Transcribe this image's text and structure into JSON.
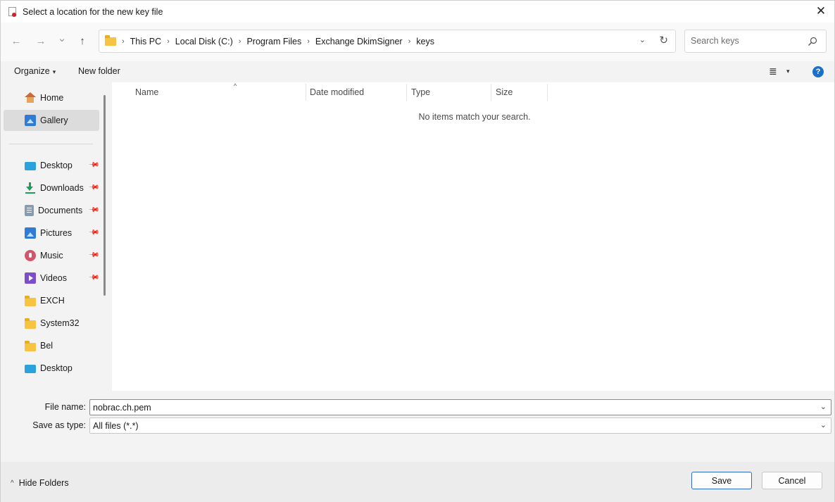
{
  "window": {
    "title": "Select a location for the new key file",
    "close_glyph": "✕"
  },
  "nav": {
    "back_glyph": "←",
    "forward_glyph": "→",
    "recent_glyph": "⌄",
    "up_glyph": "↑",
    "breadcrumbs": [
      "This PC",
      "Local Disk (C:)",
      "Program Files",
      "Exchange DkimSigner",
      "keys"
    ],
    "crumb_sep": "›",
    "address_dropdown_glyph": "⌄",
    "refresh_glyph": "↻",
    "search_placeholder": "Search keys"
  },
  "toolbar": {
    "organize_label": "Organize",
    "organize_caret": "▾",
    "new_folder_label": "New folder",
    "view_glyph": "≣",
    "view_caret": "▾",
    "help_glyph": "?"
  },
  "sidebar": {
    "items": [
      {
        "label": "Home",
        "icon": "home-icon",
        "pinned": false,
        "selected": false
      },
      {
        "label": "Gallery",
        "icon": "gallery-icon",
        "pinned": false,
        "selected": true
      },
      {
        "label": "Desktop",
        "icon": "desktop-icon",
        "pinned": true,
        "selected": false
      },
      {
        "label": "Downloads",
        "icon": "downloads-icon",
        "pinned": true,
        "selected": false
      },
      {
        "label": "Documents",
        "icon": "documents-icon",
        "pinned": true,
        "selected": false
      },
      {
        "label": "Pictures",
        "icon": "pictures-icon",
        "pinned": true,
        "selected": false
      },
      {
        "label": "Music",
        "icon": "music-icon",
        "pinned": true,
        "selected": false
      },
      {
        "label": "Videos",
        "icon": "videos-icon",
        "pinned": true,
        "selected": false
      },
      {
        "label": "EXCH",
        "icon": "folder-icon",
        "pinned": false,
        "selected": false
      },
      {
        "label": "System32",
        "icon": "folder-icon",
        "pinned": false,
        "selected": false
      },
      {
        "label": "Bel",
        "icon": "folder-icon",
        "pinned": false,
        "selected": false
      },
      {
        "label": "Desktop",
        "icon": "desktop-icon",
        "pinned": false,
        "selected": false
      }
    ],
    "pin_glyph": "📌"
  },
  "content": {
    "columns": [
      "Name",
      "Date modified",
      "Type",
      "Size"
    ],
    "sort_caret": "^",
    "empty_message": "No items match your search."
  },
  "fields": {
    "filename_label": "File name:",
    "filename_value": "nobrac.ch.pem",
    "savetype_label": "Save as type:",
    "savetype_value": "All files (*.*)",
    "caret": "⌄"
  },
  "footer": {
    "hide_folders_label": "Hide Folders",
    "hide_folders_glyph": "^",
    "save_label": "Save",
    "cancel_label": "Cancel"
  },
  "colors": {
    "accent": "#2d6cc0",
    "help_blue": "#1b6fc7",
    "folder_yellow": "#f6c343"
  }
}
